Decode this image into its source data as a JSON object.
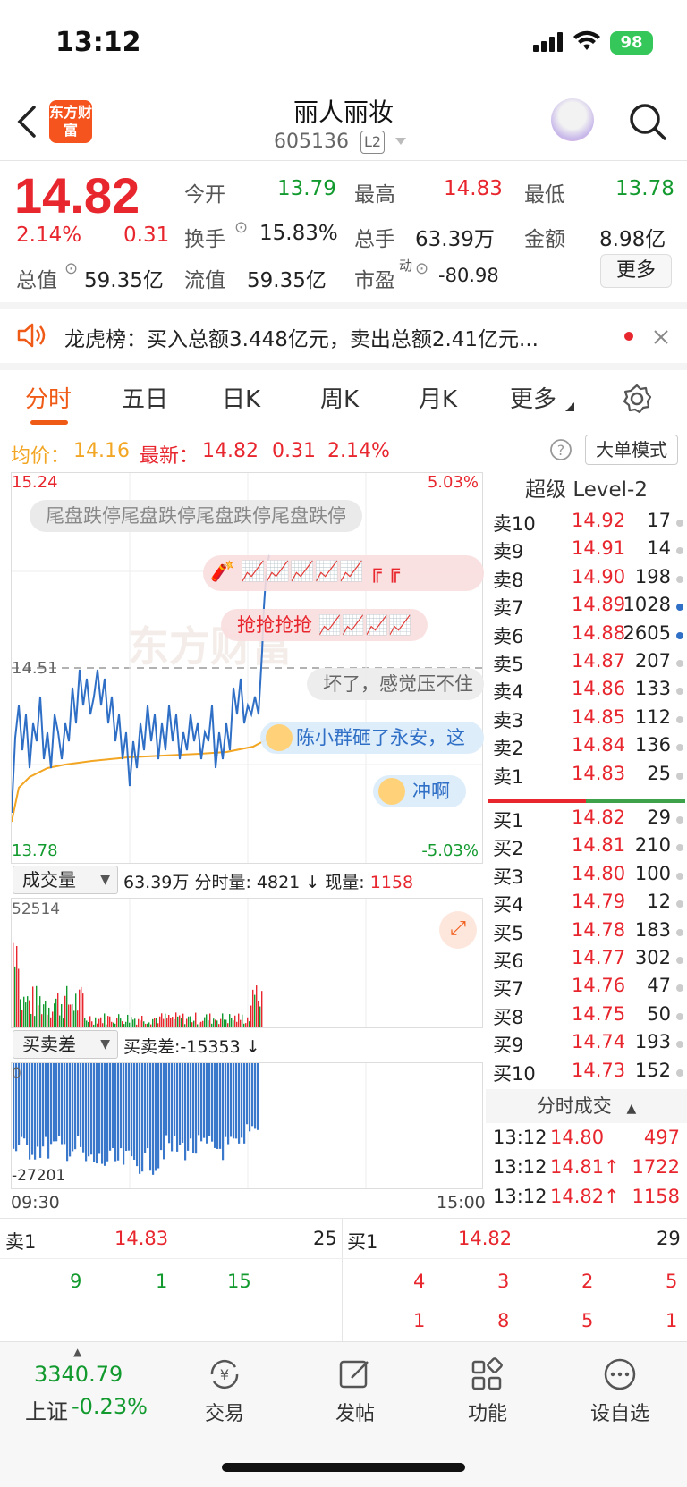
{
  "status": {
    "time": "13:12",
    "battery": "98"
  },
  "header": {
    "back_icon": "chevron-left-icon",
    "logo_text": "东方财富",
    "title": "丽人丽妆",
    "code": "605136",
    "level_badge": "L2"
  },
  "quote": {
    "price": "14.82",
    "change_pct": "2.14%",
    "change_abs": "0.31",
    "open_label": "今开",
    "open": "13.79",
    "high_label": "最高",
    "high": "14.83",
    "low_label": "最低",
    "low": "13.78",
    "turnover_label": "换手",
    "turnover": "15.83%",
    "volume_label": "总手",
    "volume": "63.39万",
    "amount_label": "金额",
    "amount": "8.98亿",
    "mktcap_label": "总值",
    "mktcap": "59.35亿",
    "float_label": "流值",
    "float": "59.35亿",
    "pe_label": "市盈",
    "pe_sup": "动",
    "pe": "-80.98",
    "more": "更多"
  },
  "dragon": {
    "text": "龙虎榜：买入总额3.448亿元，卖出总额2.41亿元..."
  },
  "tabs": [
    "分时",
    "五日",
    "日K",
    "周K",
    "月K",
    "更多"
  ],
  "avg_row": {
    "avg_label": "均价：",
    "avg": "14.16",
    "latest_label": "最新：",
    "latest": "14.82",
    "chg": "0.31",
    "pct": "2.14%",
    "mode_button": "大单模式"
  },
  "chart": {
    "top_price": "15.24",
    "top_pct": "5.03%",
    "mid_price": "14.51",
    "bottom_price": "13.78",
    "bottom_pct": "-5.03%",
    "bubbles": [
      "尾盘跌停尾盘跌停尾盘跌停尾盘跌停",
      "抢抢抢抢",
      "坏了，感觉压不住",
      "陈小群砸了永安，这",
      "冲啊"
    ],
    "watermark": "东方财富"
  },
  "volume": {
    "label": "成交量",
    "summary_total": "63.39万",
    "summary_min_label": "分时量:",
    "summary_min": "4821",
    "summary_now_label": "现量:",
    "summary_now": "1158",
    "max": "52514"
  },
  "diff": {
    "label": "买卖差",
    "value_label": "买卖差:",
    "value": "-15353",
    "zero": "0",
    "min": "-27201"
  },
  "time_axis": {
    "start": "09:30",
    "end": "15:00"
  },
  "orderbook": {
    "title": "超级 Level-2",
    "asks": [
      {
        "label": "卖10",
        "price": "14.92",
        "vol": "17"
      },
      {
        "label": "卖9",
        "price": "14.91",
        "vol": "14"
      },
      {
        "label": "卖8",
        "price": "14.90",
        "vol": "198"
      },
      {
        "label": "卖7",
        "price": "14.89",
        "vol": "1028"
      },
      {
        "label": "卖6",
        "price": "14.88",
        "vol": "2605"
      },
      {
        "label": "卖5",
        "price": "14.87",
        "vol": "207"
      },
      {
        "label": "卖4",
        "price": "14.86",
        "vol": "133"
      },
      {
        "label": "卖3",
        "price": "14.85",
        "vol": "112"
      },
      {
        "label": "卖2",
        "price": "14.84",
        "vol": "136"
      },
      {
        "label": "卖1",
        "price": "14.83",
        "vol": "25"
      }
    ],
    "bids": [
      {
        "label": "买1",
        "price": "14.82",
        "vol": "29"
      },
      {
        "label": "买2",
        "price": "14.81",
        "vol": "210"
      },
      {
        "label": "买3",
        "price": "14.80",
        "vol": "100"
      },
      {
        "label": "买4",
        "price": "14.79",
        "vol": "12"
      },
      {
        "label": "买5",
        "price": "14.78",
        "vol": "183"
      },
      {
        "label": "买6",
        "price": "14.77",
        "vol": "302"
      },
      {
        "label": "买7",
        "price": "14.76",
        "vol": "47"
      },
      {
        "label": "买8",
        "price": "14.75",
        "vol": "50"
      },
      {
        "label": "买9",
        "price": "14.74",
        "vol": "193"
      },
      {
        "label": "买10",
        "price": "14.73",
        "vol": "152"
      }
    ],
    "ticks_title": "分时成交",
    "ticks": [
      {
        "time": "13:12",
        "price": "14.80",
        "vol": "497",
        "color": "#e8262e"
      },
      {
        "time": "13:12",
        "price": "14.81↑",
        "vol": "1722",
        "color": "#e8262e"
      },
      {
        "time": "13:12",
        "price": "14.82↑",
        "vol": "1158",
        "color": "#e8262e"
      }
    ]
  },
  "level1": {
    "ask_label": "卖1",
    "ask_price": "14.83",
    "ask_vol": "25",
    "bid_label": "买1",
    "bid_price": "14.82",
    "bid_vol": "29",
    "ask_queue": [
      "9",
      "1",
      "15"
    ],
    "bid_queue_1": [
      "4",
      "3",
      "2",
      "5"
    ],
    "bid_queue_2": [
      "1",
      "8",
      "5",
      "1"
    ]
  },
  "bottom": {
    "index_value": "3340.79",
    "index_name": "上证",
    "index_pct": "-0.23%",
    "nav": [
      "交易",
      "发帖",
      "功能",
      "设自选"
    ]
  },
  "colors": {
    "up": "#e8262e",
    "down": "#129a2e",
    "accent": "#f05a17",
    "avg_line": "#f2a623",
    "price_line": "#2f6fc6"
  }
}
